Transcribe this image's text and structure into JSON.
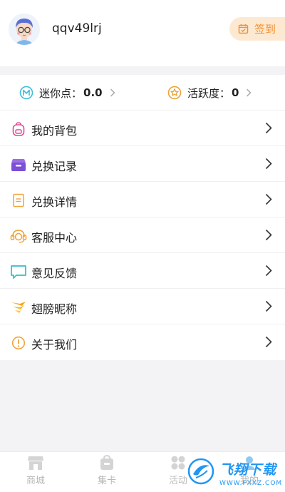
{
  "user": {
    "name": "qqv49lrj"
  },
  "signin": {
    "label": "签到"
  },
  "stats": {
    "mini": {
      "label": "迷你点：",
      "value": "0.0"
    },
    "active": {
      "label": "活跃度：",
      "value": "0"
    }
  },
  "menu": {
    "items": [
      {
        "label": "我的背包",
        "icon": "backpack-icon"
      },
      {
        "label": "兑换记录",
        "icon": "box-icon"
      },
      {
        "label": "兑换详情",
        "icon": "document-icon"
      },
      {
        "label": "客服中心",
        "icon": "headset-icon"
      },
      {
        "label": "意见反馈",
        "icon": "chat-bubble-icon"
      },
      {
        "label": "翅膀昵称",
        "icon": "wing-icon"
      },
      {
        "label": "关于我们",
        "icon": "info-icon"
      }
    ]
  },
  "tabs": [
    {
      "label": "商城",
      "icon": "store-icon"
    },
    {
      "label": "集卡",
      "icon": "card-bag-icon"
    },
    {
      "label": "活动",
      "icon": "grid-icon"
    },
    {
      "label": "我的",
      "icon": "user-icon"
    }
  ],
  "watermark": {
    "title": "飞翔下载",
    "subtitle": "WWW.FXXZ.COM"
  },
  "colors": {
    "accent": "#f29134",
    "signin_bg": "#fde9d2",
    "watermark": "#2196f3"
  }
}
